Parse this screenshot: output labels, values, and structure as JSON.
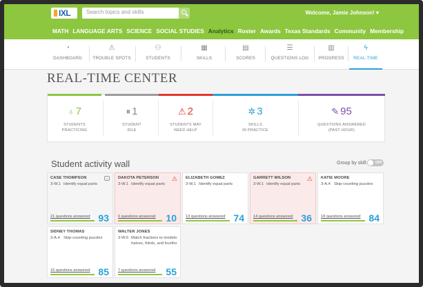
{
  "header": {
    "logo": "IXL",
    "search_placeholder": "Search topics and skills",
    "welcome": "Welcome, Jamie Johnson! ▾",
    "nav": [
      "MATH",
      "LANGUAGE ARTS",
      "SCIENCE",
      "SOCIAL STUDIES",
      "Analytics",
      "Roster",
      "Awards",
      "Texas Standards",
      "Community",
      "Membership"
    ],
    "active_nav": "Analytics"
  },
  "subnav": [
    {
      "label": "DASHBOARD",
      "icon": "dashboard-icon"
    },
    {
      "label": "TROUBLE SPOTS",
      "icon": "warning-icon"
    },
    {
      "label": "STUDENTS",
      "icon": "students-icon"
    },
    {
      "label": "SKILLS",
      "icon": "skills-icon"
    },
    {
      "label": "SCORES",
      "icon": "scores-icon"
    },
    {
      "label": "QUESTIONS LOG",
      "icon": "list-icon"
    },
    {
      "label": "PROGRESS",
      "icon": "progress-icon"
    },
    {
      "label": "REAL-TIME",
      "icon": "lightning-icon",
      "active": true
    }
  ],
  "page_title": "REAL-TIME CENTER",
  "stats": [
    {
      "value": "7",
      "label_1": "STUDENTS",
      "label_2": "PRACTICING",
      "color": "#8dc63f"
    },
    {
      "value": "1",
      "label_1": "STUDENT",
      "label_2": "IDLE",
      "color": "#9b9b9b"
    },
    {
      "value": "2",
      "label_1": "STUDENTS MAY",
      "label_2": "NEED HELP",
      "color": "#e2352a"
    },
    {
      "value": "3",
      "label_1": "SKILLS",
      "label_2": "IN PRACTICE",
      "color": "#2aa0d8"
    },
    {
      "value": "95",
      "label_1": "QUESTIONS ANSWERED",
      "label_2": "(PAST HOUR)",
      "color": "#7b4fa8"
    }
  ],
  "wall": {
    "title": "Student activity wall",
    "group_by_label": "Group by skill:",
    "toggle_label": "OFF",
    "cards": [
      {
        "name": "CASE THOMPSON",
        "code": "3-W.1",
        "skill": "Identify equal parts",
        "questions": "21 questions answered",
        "score": "93",
        "status": "idle"
      },
      {
        "name": "DAKOTA PETERSON",
        "code": "3-W.1",
        "skill": "Identify equal parts",
        "questions": "6 questions answered",
        "score": "10",
        "status": "help"
      },
      {
        "name": "ELIZABETH GOMEZ",
        "code": "3-W.1",
        "skill": "Identify equal parts",
        "questions": "13 questions answered",
        "score": "74",
        "status": "normal"
      },
      {
        "name": "GARRETT WILSON",
        "code": "3-W.1",
        "skill": "Identify equal parts",
        "questions": "14 questions answered",
        "score": "36",
        "status": "help"
      },
      {
        "name": "KATIE MOORE",
        "code": "3-A.4",
        "skill": "Skip-counting puzzles",
        "questions": "18 questions answered",
        "score": "84",
        "status": "normal"
      },
      {
        "name": "SIDNEY THOMAS",
        "code": "3-A.4",
        "skill": "Skip-counting puzzles",
        "questions": "16 questions answered",
        "score": "85",
        "status": "normal"
      },
      {
        "name": "WALTER JONES",
        "code": "3-W.6",
        "skill": "Match fractions to models: halves, thirds, and fourths",
        "questions": "7 questions answered",
        "score": "55",
        "status": "normal"
      }
    ]
  }
}
